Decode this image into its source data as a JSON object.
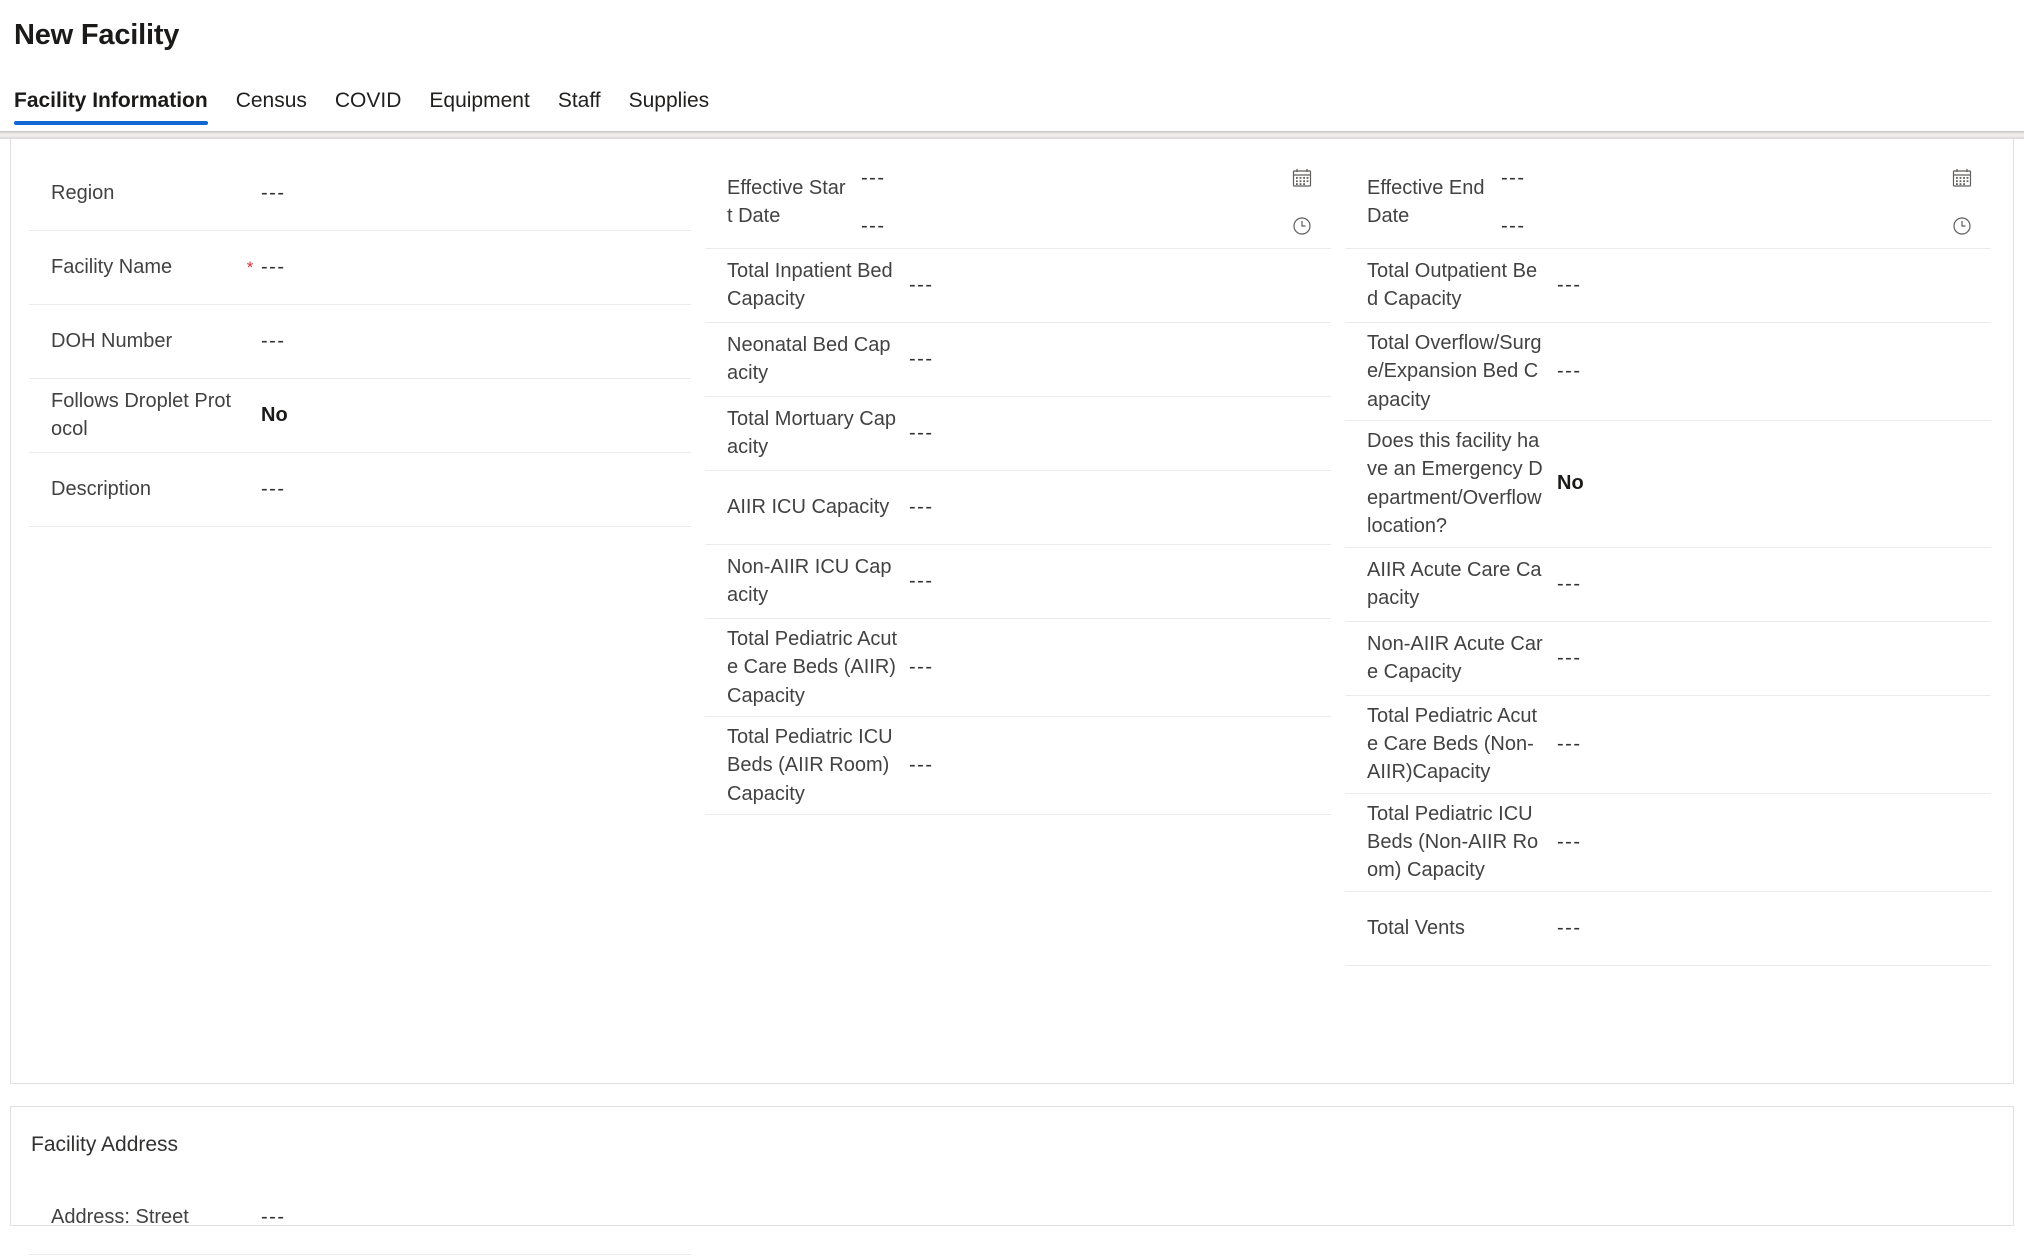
{
  "page": {
    "title": "New Facility",
    "accent_color": "#1267d4",
    "required_marker": "*",
    "empty_value": "---"
  },
  "tabs": [
    {
      "label": "Facility Information",
      "selected": true
    },
    {
      "label": "Census",
      "selected": false
    },
    {
      "label": "COVID",
      "selected": false
    },
    {
      "label": "Equipment",
      "selected": false
    },
    {
      "label": "Staff",
      "selected": false
    },
    {
      "label": "Supplies",
      "selected": false
    }
  ],
  "columns": {
    "left": [
      {
        "label": "Region",
        "value": "---",
        "required": false
      },
      {
        "label": "Facility Name",
        "value": "---",
        "required": true
      },
      {
        "label": "DOH Number",
        "value": "---",
        "required": false
      },
      {
        "label": "Follows Droplet Protocol",
        "value": "No",
        "required": false,
        "bold": true
      },
      {
        "label": "Description",
        "value": "---",
        "required": false
      }
    ],
    "middle": [
      {
        "label": "Effective Start Date",
        "type": "datetime",
        "date_value": "---",
        "time_value": "---",
        "date_icon": "calendar-icon",
        "time_icon": "clock-icon"
      },
      {
        "label": "Total Inpatient Bed Capacity",
        "value": "---"
      },
      {
        "label": "Neonatal Bed Capacity",
        "value": "---"
      },
      {
        "label": "Total Mortuary Capacity",
        "value": "---"
      },
      {
        "label": "AIIR ICU Capacity",
        "value": "---"
      },
      {
        "label": "Non-AIIR ICU Capacity",
        "value": "---"
      },
      {
        "label": "Total Pediatric Acute Care Beds (AIIR) Capacity",
        "value": "---"
      },
      {
        "label": "Total Pediatric ICU Beds (AIIR Room) Capacity",
        "value": "---"
      }
    ],
    "right": [
      {
        "label": "Effective End Date",
        "type": "datetime",
        "date_value": "---",
        "time_value": "---",
        "date_icon": "calendar-icon",
        "time_icon": "clock-icon"
      },
      {
        "label": "Total Outpatient Bed Capacity",
        "value": "---"
      },
      {
        "label": "Total Overflow/Surge/Expansion Bed Capacity",
        "value": "---"
      },
      {
        "label": "Does this facility have an Emergency Department/Overflow location?",
        "value": "No",
        "bold": true
      },
      {
        "label": "AIIR Acute Care Capacity",
        "value": "---"
      },
      {
        "label": "Non-AIIR Acute Care Capacity",
        "value": "---"
      },
      {
        "label": "Total Pediatric Acute Care Beds (Non-AIIR)Capacity",
        "value": "---"
      },
      {
        "label": "Total Pediatric ICU Beds (Non-AIIR Room) Capacity",
        "value": "---"
      },
      {
        "label": "Total Vents",
        "value": "---"
      }
    ]
  },
  "address_section": {
    "heading": "Facility Address",
    "rows": [
      {
        "label": "Address: Street",
        "value": "---"
      }
    ]
  }
}
